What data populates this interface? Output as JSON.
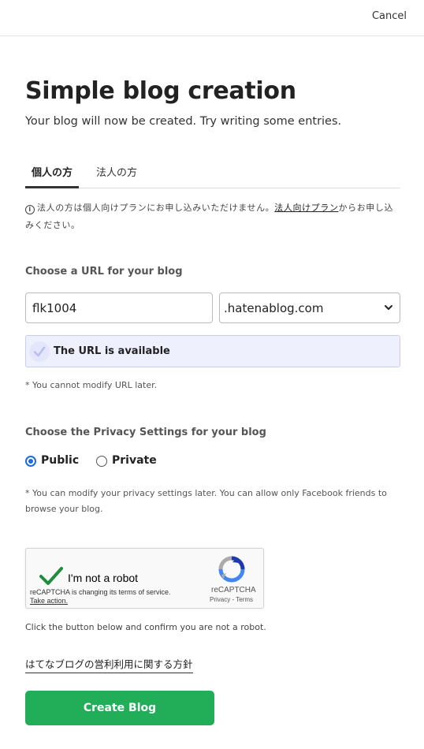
{
  "header": {
    "cancel_label": "Cancel"
  },
  "page": {
    "title": "Simple blog creation",
    "subtitle": "Your blog will now be created. Try writing some entries."
  },
  "tabs": [
    {
      "label": "個人の方",
      "active": true
    },
    {
      "label": "法人の方",
      "active": false
    }
  ],
  "notice": {
    "icon": "info-icon",
    "text_before": "法人の方は個人向けプランにお申し込みいただけません。",
    "link_text": "法人向けプラン",
    "text_after": "からお申し込みください。"
  },
  "url_section": {
    "label": "Choose a URL for your blog",
    "subdomain_value": "flk1004",
    "domain_selected": ".hatenablog.com",
    "status_text": "The URL is available",
    "status_icon": "check-icon",
    "note": "* You cannot modify URL later."
  },
  "privacy_section": {
    "label": "Choose the Privacy Settings for your blog",
    "options": [
      {
        "label": "Public",
        "checked": true
      },
      {
        "label": "Private",
        "checked": false
      }
    ],
    "note": "* You can modify your privacy settings later. You can allow only Facebook friends to browse your blog."
  },
  "captcha": {
    "label": "I'm not a robot",
    "change_notice": "reCAPTCHA is changing its terms of service.",
    "take_action": "Take action.",
    "brand": "reCAPTCHA",
    "privacy_link": "Privacy",
    "separator": " - ",
    "terms_link": "Terms"
  },
  "confirm_text": "Click the button below and confirm you are not a robot.",
  "policy_link": "はてなブログの営利利用に関する方針",
  "create_button_label": "Create Blog",
  "colors": {
    "primary_green": "#22ad59",
    "radio_blue": "#1a6ed8",
    "available_bg": "#eef0fe",
    "check_green": "#1e8e3e"
  }
}
